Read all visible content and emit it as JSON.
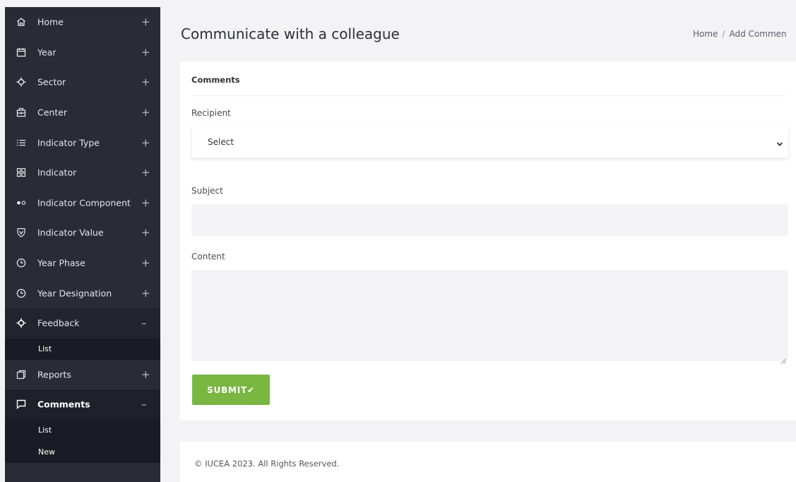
{
  "sidebar": {
    "items": [
      {
        "label": "Home",
        "icon": "home-icon",
        "toggle": "+"
      },
      {
        "label": "Year",
        "icon": "calendar-icon",
        "toggle": "+"
      },
      {
        "label": "Sector",
        "icon": "crosshair-icon",
        "toggle": "+"
      },
      {
        "label": "Center",
        "icon": "building-icon",
        "toggle": "+"
      },
      {
        "label": "Indicator Type",
        "icon": "list-icon",
        "toggle": "+"
      },
      {
        "label": "Indicator",
        "icon": "grid-icon",
        "toggle": "+"
      },
      {
        "label": "Indicator Component",
        "icon": "dots-icon",
        "toggle": "+"
      },
      {
        "label": "Indicator Value",
        "icon": "shield-icon",
        "toggle": "+"
      },
      {
        "label": "Year Phase",
        "icon": "clock-icon",
        "toggle": "+"
      },
      {
        "label": "Year Designation",
        "icon": "clock-icon",
        "toggle": "+"
      },
      {
        "label": "Feedback",
        "icon": "crosshair-icon",
        "toggle": "–"
      },
      {
        "label": "Reports",
        "icon": "copy-icon",
        "toggle": "+"
      },
      {
        "label": "Comments",
        "icon": "chat-icon",
        "toggle": "–"
      }
    ],
    "feedback_sub": [
      "List"
    ],
    "comments_sub": [
      "List",
      "New"
    ]
  },
  "header": {
    "title": "Communicate with a colleague",
    "breadcrumb_home": "Home",
    "breadcrumb_sep": "/",
    "breadcrumb_current": "Add Commen"
  },
  "form": {
    "card_title": "Comments",
    "recipient_label": "Recipient",
    "recipient_value": "Select",
    "subject_label": "Subject",
    "subject_value": "",
    "content_label": "Content",
    "content_value": "",
    "submit_label": "SUBMIT✔"
  },
  "footer": {
    "text": "© IUCEA 2023. All Rights Reserved."
  },
  "colors": {
    "sidebar_bg": "#2a2b36",
    "accent_green": "#7ab642",
    "page_bg": "#f3f3f5"
  }
}
